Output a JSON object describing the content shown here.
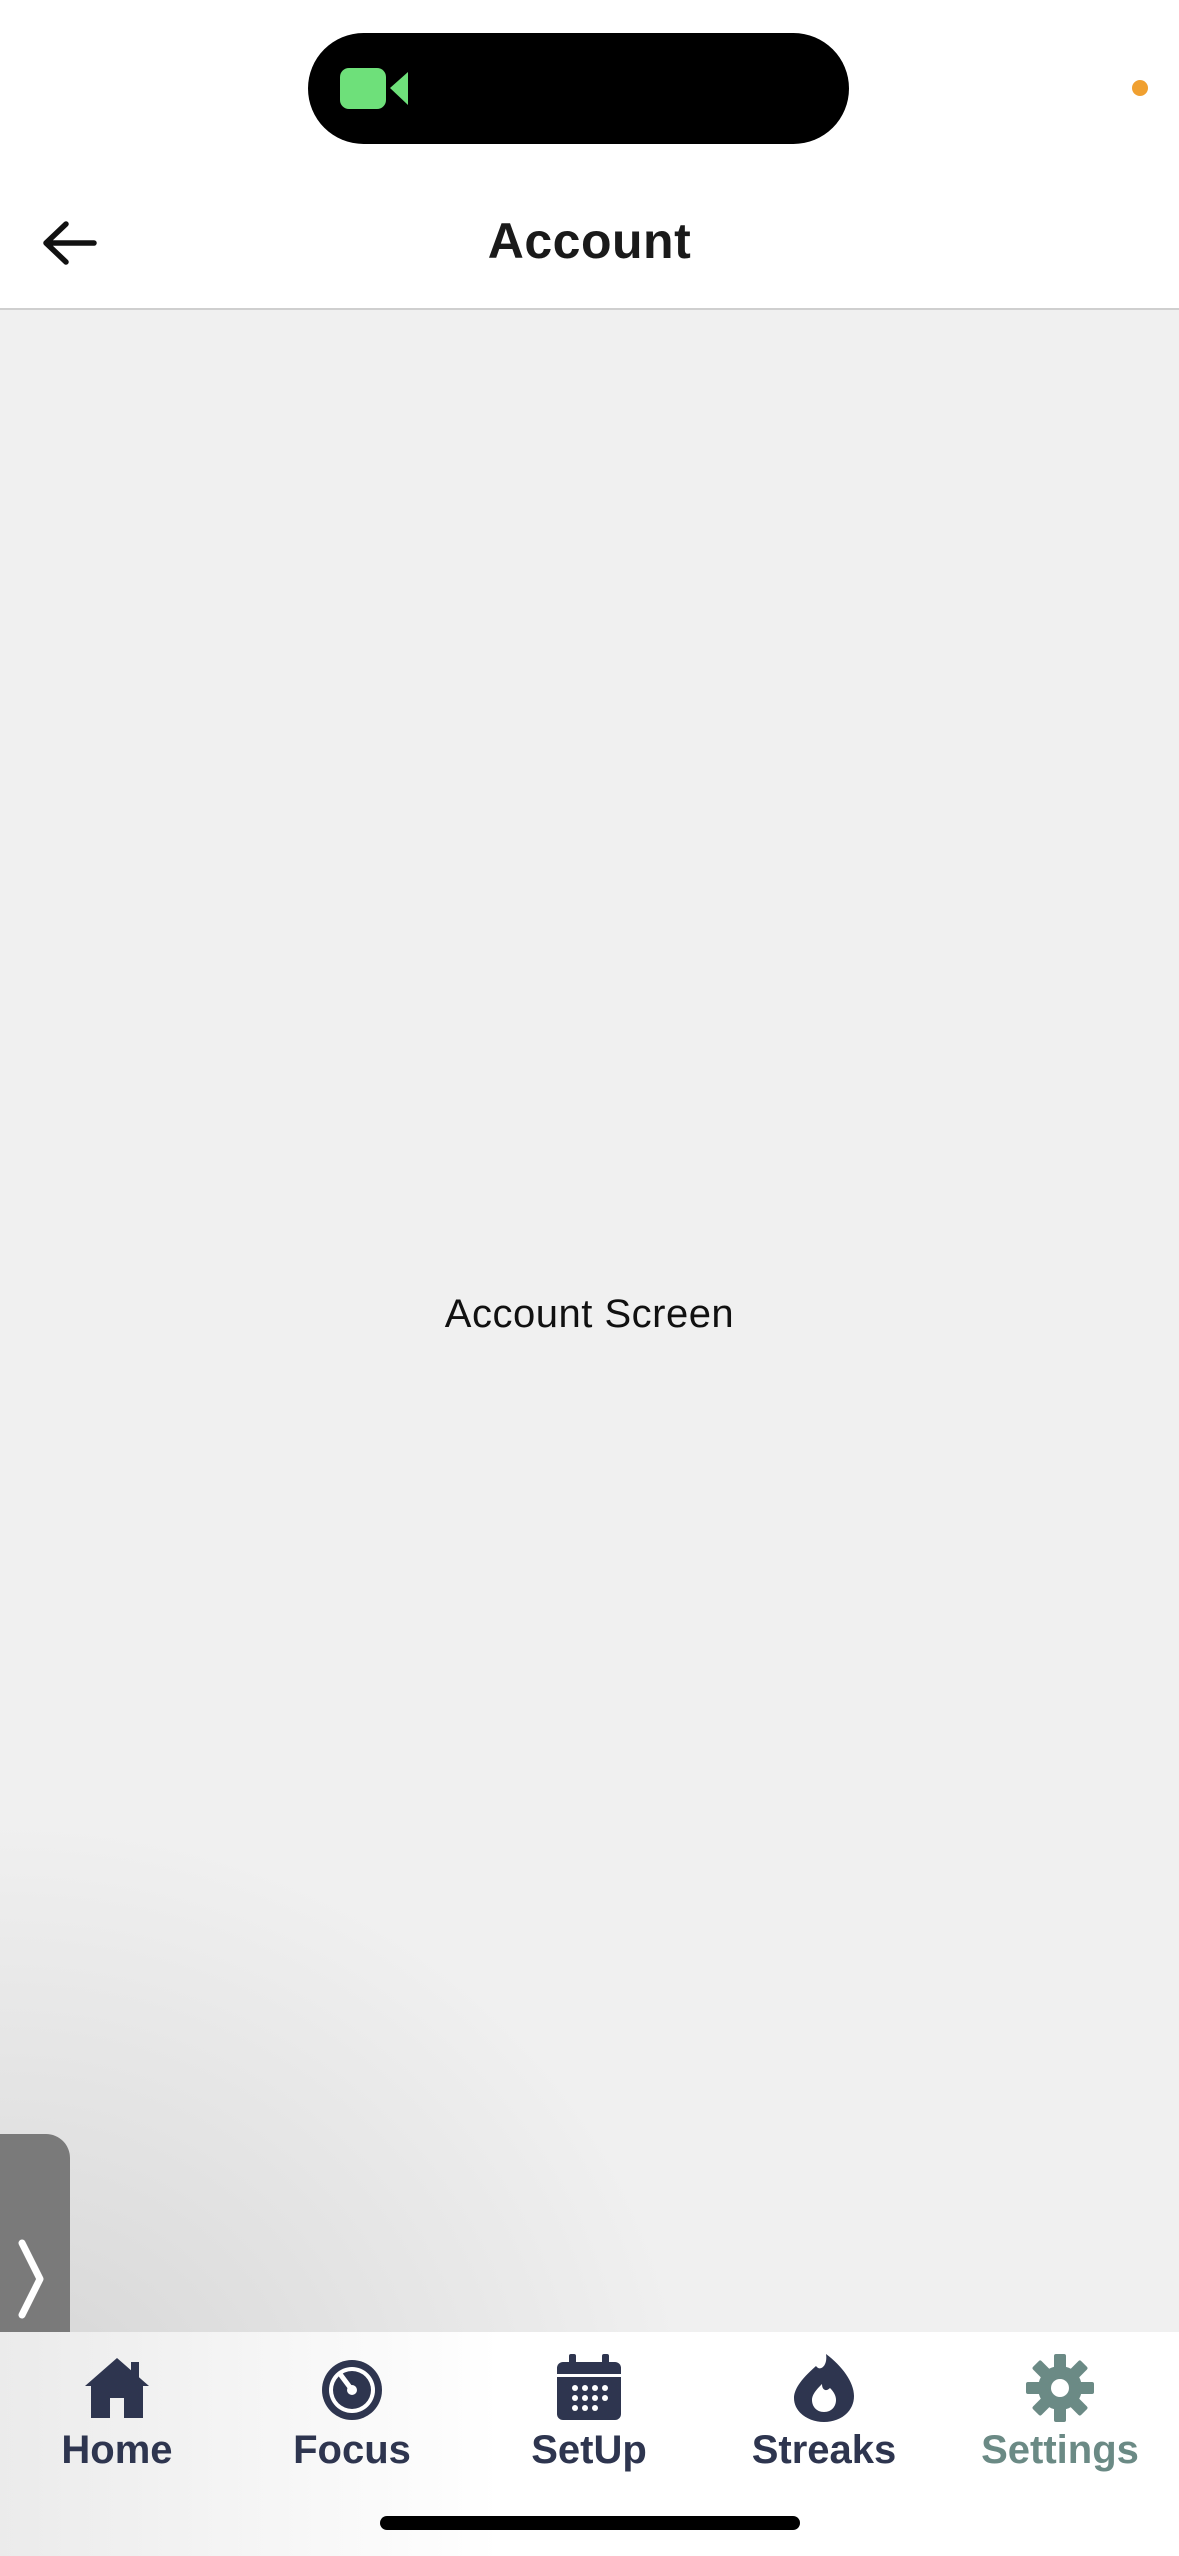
{
  "status_bar": {
    "camera_icon": "video-camera-icon",
    "camera_color": "#6ee07a",
    "indicator_color": "#f0a030"
  },
  "header": {
    "back_icon": "arrow-left-icon",
    "title": "Account"
  },
  "content": {
    "placeholder_text": "Account Screen"
  },
  "drawer": {
    "icon": "chevron-right-icon"
  },
  "tab_bar": {
    "tabs": [
      {
        "label": "Home",
        "icon": "house-icon",
        "active": false
      },
      {
        "label": "Focus",
        "icon": "stopwatch-icon",
        "active": false
      },
      {
        "label": "SetUp",
        "icon": "calendar-icon",
        "active": false
      },
      {
        "label": "Streaks",
        "icon": "flame-icon",
        "active": false
      },
      {
        "label": "Settings",
        "icon": "gear-icon",
        "active": true
      }
    ],
    "inactive_color": "#2e354f",
    "active_color": "#6b8a85"
  }
}
